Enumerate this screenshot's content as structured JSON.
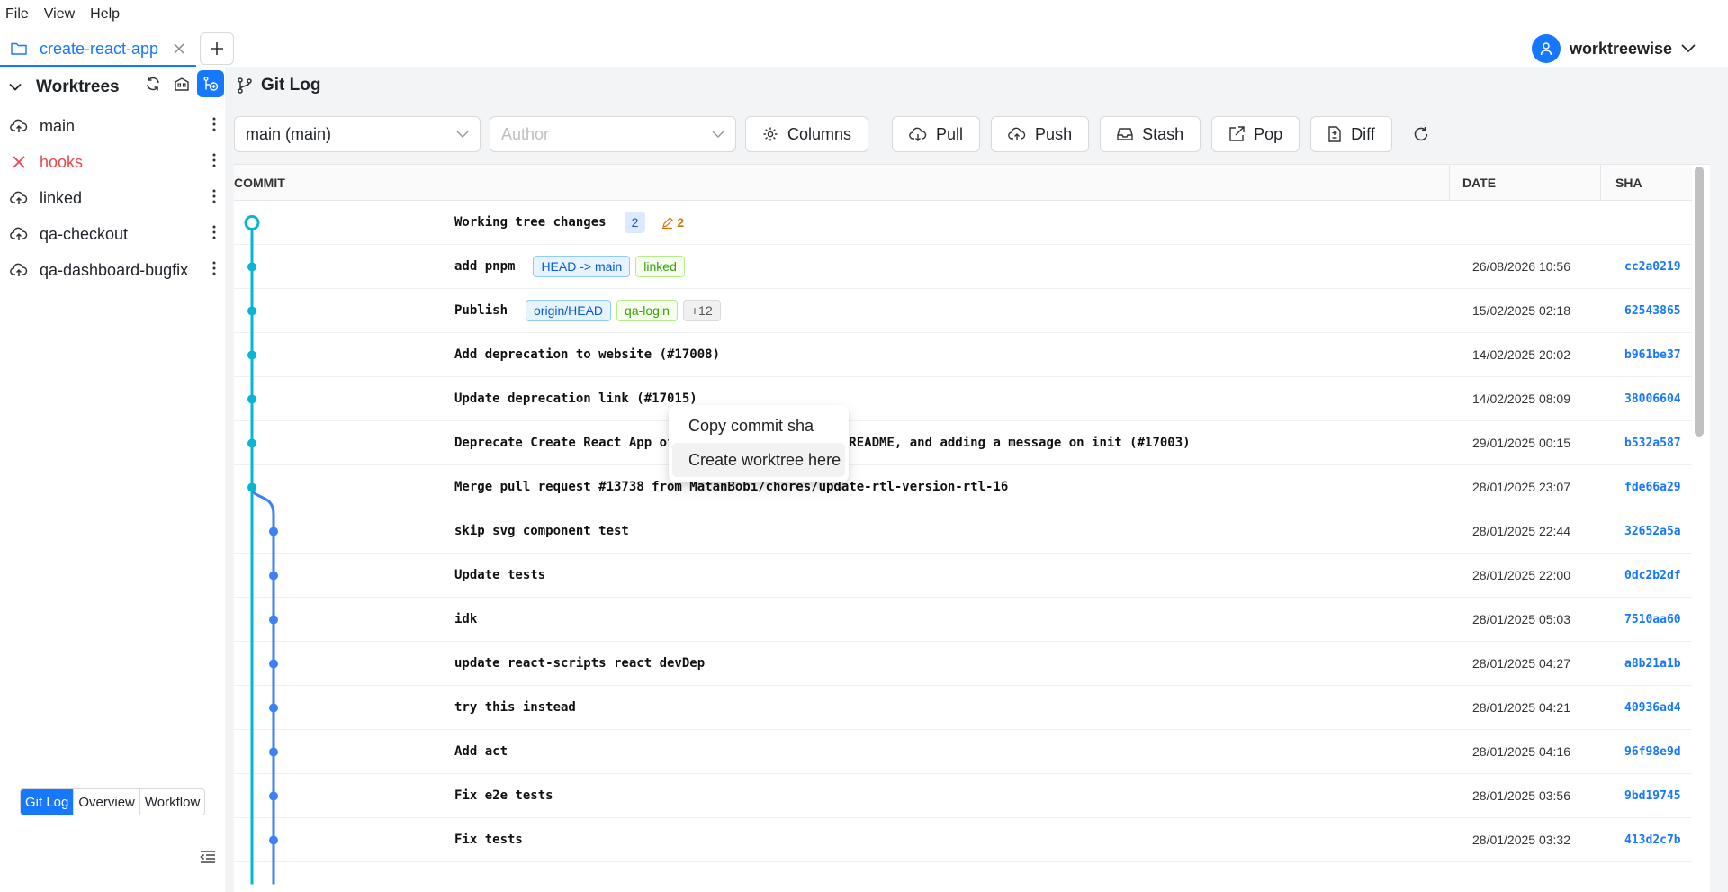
{
  "menu": [
    "File",
    "View",
    "Help"
  ],
  "tab": {
    "label": "create-react-app"
  },
  "user": {
    "name": "worktreewise"
  },
  "sidebar": {
    "title": "Worktrees",
    "items": [
      {
        "label": "main",
        "status": "cloud"
      },
      {
        "label": "hooks",
        "status": "error"
      },
      {
        "label": "linked",
        "status": "cloud"
      },
      {
        "label": "qa-checkout",
        "status": "cloud"
      },
      {
        "label": "qa-dashboard-bugfix",
        "status": "cloud"
      }
    ],
    "views": [
      "Git Log",
      "Overview",
      "Workflow"
    ],
    "active_view": "Git Log"
  },
  "panel": {
    "title": "Git Log"
  },
  "toolbar": {
    "branch_value": "main (main)",
    "author_placeholder": "Author",
    "columns": "Columns",
    "pull": "Pull",
    "push": "Push",
    "stash": "Stash",
    "pop": "Pop",
    "diff": "Diff"
  },
  "table": {
    "headers": {
      "commit": "COMMIT",
      "date": "DATE",
      "sha": "SHA"
    },
    "working": {
      "message": "Working tree changes",
      "count": "2",
      "modified": "2"
    },
    "rows": [
      {
        "message": "add pnpm",
        "tags": [
          {
            "label": "HEAD -> main",
            "kind": "head"
          },
          {
            "label": "linked",
            "kind": "green"
          }
        ],
        "date": "26/08/2026 10:56",
        "sha": "cc2a0219",
        "lane": 0
      },
      {
        "message": "Publish",
        "tags": [
          {
            "label": "origin/HEAD",
            "kind": "head"
          },
          {
            "label": "qa-login",
            "kind": "green"
          },
          {
            "label": "+12",
            "kind": "gray"
          }
        ],
        "date": "15/02/2025 02:18",
        "sha": "62543865",
        "lane": 0
      },
      {
        "message": "Add deprecation to website (#17008)",
        "tags": [],
        "date": "14/02/2025 20:02",
        "sha": "b961be37",
        "lane": 0
      },
      {
        "message": "Update deprecation link (#17015)",
        "tags": [],
        "date": "14/02/2025 08:09",
        "sha": "38006604",
        "lane": 0
      },
      {
        "message": "Deprecate Create React App officially, updating the README, and adding a message on init (#17003)",
        "tags": [],
        "date": "29/01/2025 00:15",
        "sha": "b532a587",
        "lane": 0
      },
      {
        "message": "Merge pull request #13738 from MatanBobi/chores/update-rtl-version-rtl-16",
        "tags": [],
        "date": "28/01/2025 23:07",
        "sha": "fde66a29",
        "lane": 0
      },
      {
        "message": "skip svg component test",
        "tags": [],
        "date": "28/01/2025 22:44",
        "sha": "32652a5a",
        "lane": 1
      },
      {
        "message": "Update tests",
        "tags": [],
        "date": "28/01/2025 22:00",
        "sha": "0dc2b2df",
        "lane": 1
      },
      {
        "message": "idk",
        "tags": [],
        "date": "28/01/2025 05:03",
        "sha": "7510aa60",
        "lane": 1
      },
      {
        "message": "update react-scripts react devDep",
        "tags": [],
        "date": "28/01/2025 04:27",
        "sha": "a8b21a1b",
        "lane": 1
      },
      {
        "message": "try this instead",
        "tags": [],
        "date": "28/01/2025 04:21",
        "sha": "40936ad4",
        "lane": 1
      },
      {
        "message": "Add act",
        "tags": [],
        "date": "28/01/2025 04:16",
        "sha": "96f98e9d",
        "lane": 1
      },
      {
        "message": "Fix e2e tests",
        "tags": [],
        "date": "28/01/2025 03:56",
        "sha": "9bd19745",
        "lane": 1
      },
      {
        "message": "Fix tests",
        "tags": [],
        "date": "28/01/2025 03:32",
        "sha": "413d2c7b",
        "lane": 1
      }
    ]
  },
  "context_menu": {
    "items": [
      "Copy commit sha",
      "Create worktree here"
    ],
    "hovered": 1
  },
  "colors": {
    "accent": "#1677ff",
    "lane0": "#06b6d4",
    "lane1": "#3b82f6",
    "error": "#e5484d"
  }
}
